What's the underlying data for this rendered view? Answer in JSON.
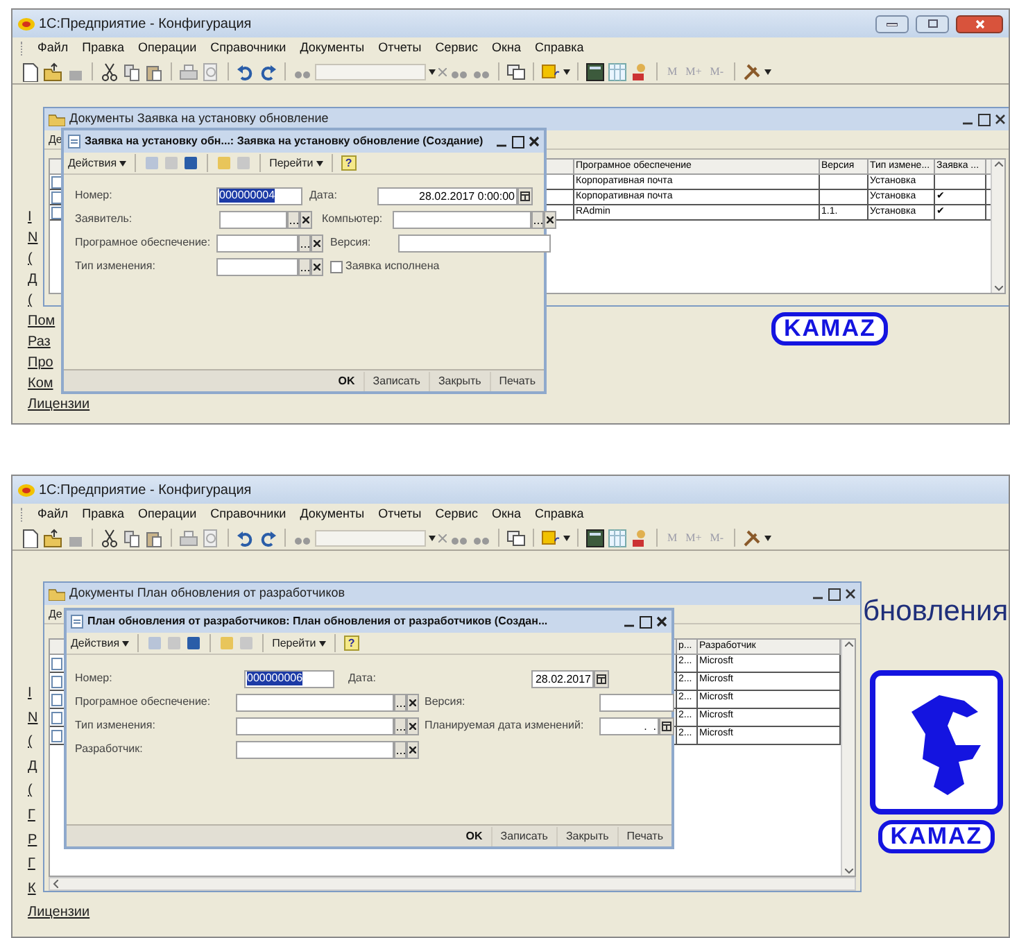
{
  "screens": [
    {
      "app_title": "1С:Предприятие - Конфигурация",
      "menu": [
        "Файл",
        "Правка",
        "Операции",
        "Справочники",
        "Документы",
        "Отчеты",
        "Сервис",
        "Окна",
        "Справка"
      ],
      "memory_buttons": [
        "M",
        "M+",
        "M-"
      ],
      "window_controls": true,
      "side_links": [
        "I",
        "N",
        "(",
        "Д",
        "(",
        "Пом",
        "Раз",
        "Про",
        "Ком",
        "Лицензии"
      ],
      "logo": {
        "kind": "text",
        "text": "KAMAZ"
      },
      "list_window": {
        "title": "Документы Заявка на установку обновление",
        "tab_stub": "Де",
        "columns": [
          "Програмное обеспечение",
          "Версия",
          "Тип измене...",
          "Заявка ..."
        ],
        "rows": [
          {
            "cells": [
              "Корпоративная почта",
              "",
              "Установка",
              ""
            ]
          },
          {
            "cells": [
              "Корпоративная почта",
              "",
              "Установка",
              "✔"
            ]
          },
          {
            "cells": [
              "RAdmin",
              "1.1.",
              "Установка",
              "✔"
            ]
          }
        ]
      },
      "form": {
        "title": "Заявка на установку обн...: Заявка на установку обновление (Создание)",
        "actions": "Действия",
        "goto": "Перейти",
        "help": "?",
        "rows": [
          [
            {
              "label": "Номер:",
              "kind": "number",
              "value": "000000004"
            },
            {
              "label": "Дата:",
              "kind": "date",
              "value": "28.02.2017 0:00:00"
            }
          ],
          [
            {
              "label": "Заявитель:",
              "kind": "ref"
            },
            {
              "label": "Компьютер:",
              "kind": "ref"
            }
          ],
          [
            {
              "label": "Програмное обеспечение:",
              "kind": "ref"
            },
            {
              "label": "Версия:",
              "kind": "text"
            }
          ],
          [
            {
              "label": "Тип изменения:",
              "kind": "ref"
            },
            {
              "label": "Заявка исполнена",
              "kind": "checkbox",
              "checked": false
            }
          ]
        ],
        "buttons": [
          "OK",
          "Записать",
          "Закрыть",
          "Печать"
        ]
      }
    },
    {
      "app_title": "1С:Предприятие - Конфигурация",
      "menu": [
        "Файл",
        "Правка",
        "Операции",
        "Справочники",
        "Документы",
        "Отчеты",
        "Сервис",
        "Окна",
        "Справка"
      ],
      "memory_buttons": [
        "M",
        "M+",
        "M-"
      ],
      "window_controls": false,
      "side_links": [
        "I",
        "N",
        "(",
        "Д",
        "(",
        "Г",
        "Р",
        "Г",
        "К",
        "Лицензии"
      ],
      "background_text": "бновления",
      "logo": {
        "kind": "horse",
        "text": "KAMAZ"
      },
      "list_window": {
        "title": "Документы План обновления от разработчиков",
        "tab_stub": "Де",
        "columns": [
          "р...",
          "Разработчик"
        ],
        "rows": [
          {
            "cells": [
              "2...",
              "Microsft"
            ]
          },
          {
            "cells": [
              "2...",
              "Microsft"
            ]
          },
          {
            "cells": [
              "2...",
              "Microsft"
            ]
          },
          {
            "cells": [
              "2...",
              "Microsft"
            ]
          },
          {
            "cells": [
              "2...",
              "Microsft"
            ]
          }
        ]
      },
      "form": {
        "title": "План обновления от разработчиков: План обновления от разработчиков (Создан...",
        "actions": "Действия",
        "goto": "Перейти",
        "help": "?",
        "rows": [
          [
            {
              "label": "Номер:",
              "kind": "number",
              "value": "000000006"
            },
            {
              "label": "Дата:",
              "kind": "date",
              "value": "28.02.2017"
            }
          ],
          [
            {
              "label": "Програмное обеспечение:",
              "kind": "ref"
            },
            {
              "label": "Версия:",
              "kind": "text"
            }
          ],
          [
            {
              "label": "Тип изменения:",
              "kind": "ref"
            },
            {
              "label": "Планируемая дата изменений:",
              "kind": "date",
              "value": " .  ."
            }
          ],
          [
            {
              "label": "Разработчик:",
              "kind": "ref"
            }
          ]
        ],
        "buttons": [
          "OK",
          "Записать",
          "Закрыть",
          "Печать"
        ]
      }
    }
  ]
}
